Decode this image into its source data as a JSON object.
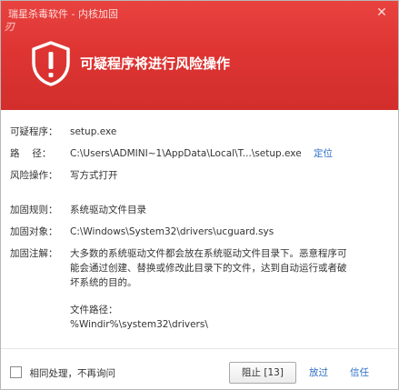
{
  "window": {
    "title": "瑞星杀毒软件 - 内核加固",
    "close_symbol": "✕",
    "logo_text": "刃"
  },
  "header": {
    "headline": "可疑程序将进行风险操作"
  },
  "details": {
    "program_label": "可疑程序：",
    "program_value": "setup.exe",
    "path_label": "路　 径：",
    "path_value": "C:\\Users\\ADMINI~1\\AppData\\Local\\T...\\setup.exe",
    "locate_link": "定位",
    "risk_label": "风险操作：",
    "risk_value": "写方式打开",
    "rule_label": "加固规则：",
    "rule_value": "系统驱动文件目录",
    "target_label": "加固对象：",
    "target_value": "C:\\Windows\\System32\\drivers\\ucguard.sys",
    "note_label": "加固注解：",
    "note_line1": "大多数的系统驱动文件都会放在系统驱动文件目录下。恶意程序可",
    "note_line2": "能会通过创建、替换或修改此目录下的文件，达到自动运行或者破",
    "note_line3": "坏系统的目的。",
    "filepath_label": "文件路径：",
    "filepath_value": "%Windir%\\system32\\drivers\\"
  },
  "footer": {
    "checkbox_label": "相同处理，不再询问",
    "checkbox_checked": false,
    "block_button": "阻止 [13]",
    "allow_button": "放过",
    "trust_button": "信任"
  },
  "colors": {
    "header_red": "#de3533",
    "link_blue": "#2b6ec7",
    "risk_red": "#e0302c"
  }
}
